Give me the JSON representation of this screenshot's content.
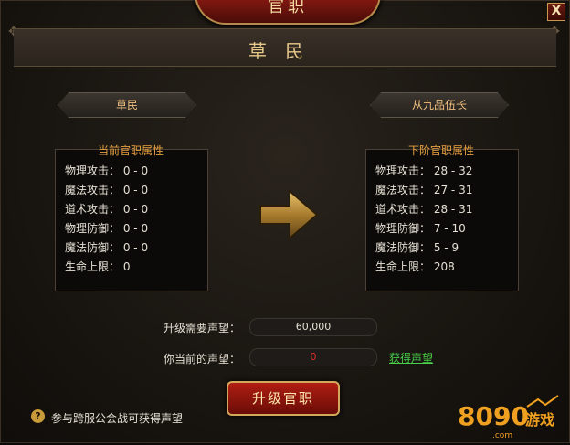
{
  "window": {
    "title": "官职",
    "close_label": "X"
  },
  "banner": {
    "rank_name": "草民"
  },
  "current": {
    "rank": "草民",
    "title": "当前官职属性",
    "rows": [
      {
        "label": "物理攻击：",
        "value": "0 - 0"
      },
      {
        "label": "魔法攻击：",
        "value": "0 - 0"
      },
      {
        "label": "道术攻击：",
        "value": "0 - 0"
      },
      {
        "label": "物理防御：",
        "value": "0 - 0"
      },
      {
        "label": "魔法防御：",
        "value": "0 - 0"
      },
      {
        "label": "生命上限：",
        "value": "0"
      }
    ]
  },
  "next": {
    "rank": "从九品伍长",
    "title": "下阶官职属性",
    "rows": [
      {
        "label": "物理攻击：",
        "value": "28 - 32"
      },
      {
        "label": "魔法攻击：",
        "value": "27 - 31"
      },
      {
        "label": "道术攻击：",
        "value": "28 - 31"
      },
      {
        "label": "物理防御：",
        "value": "7 - 10"
      },
      {
        "label": "魔法防御：",
        "value": "5 - 9"
      },
      {
        "label": "生命上限：",
        "value": "208"
      }
    ]
  },
  "upgrade": {
    "required_label": "升级需要声望：",
    "required_value": "60,000",
    "current_label": "你当前的声望：",
    "current_value": "0",
    "get_link": "获得声望",
    "button_label": "升级官职"
  },
  "hint": {
    "icon": "?",
    "text": "参与跨服公会战可获得声望"
  },
  "colors": {
    "current_value": "#e03030",
    "link": "#48d048"
  },
  "watermark": {
    "digits": "8090",
    "text": "游戏",
    "domain": ".com"
  }
}
